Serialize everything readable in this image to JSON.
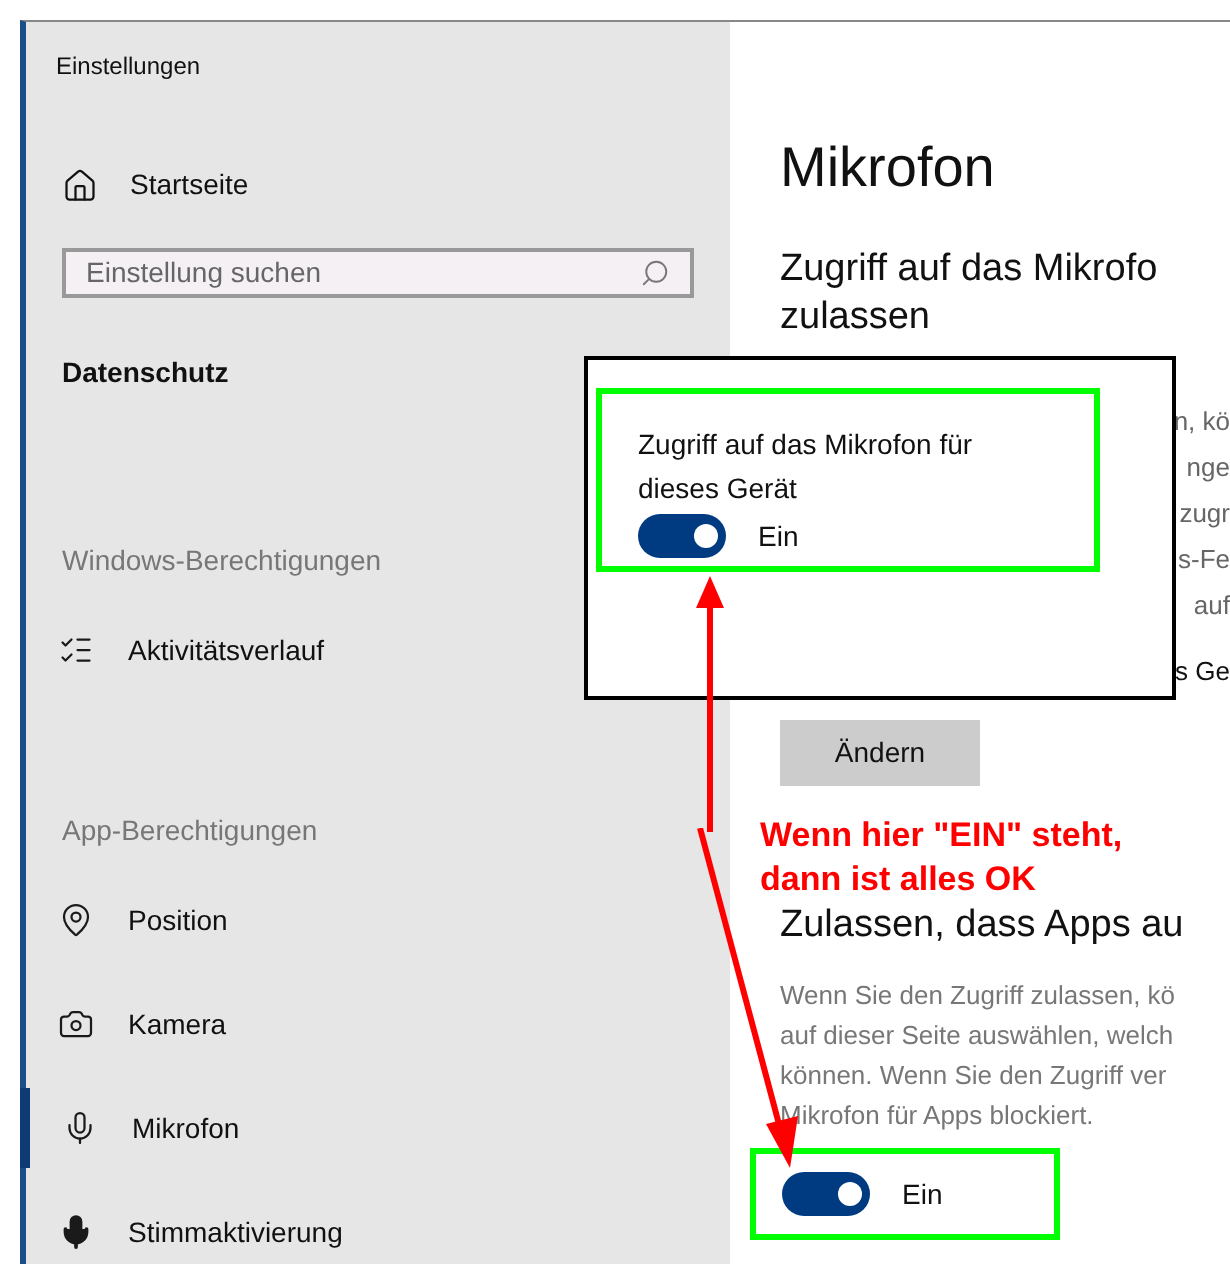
{
  "window": {
    "title": "Einstellungen"
  },
  "sidebar": {
    "home": {
      "label": "Startseite"
    },
    "search": {
      "placeholder": "Einstellung suchen"
    },
    "section_title": "Datenschutz",
    "groups": [
      {
        "heading": "Windows-Berechtigungen",
        "items": [
          {
            "label": "Aktivitätsverlauf",
            "kind": "activity",
            "selected": false
          }
        ]
      },
      {
        "heading": "App-Berechtigungen",
        "items": [
          {
            "label": "Position",
            "kind": "position",
            "selected": false
          },
          {
            "label": "Kamera",
            "kind": "camera",
            "selected": false
          },
          {
            "label": "Mikrofon",
            "kind": "microphone",
            "selected": true
          },
          {
            "label": "Stimmaktivierung",
            "kind": "voice",
            "selected": false
          }
        ]
      }
    ]
  },
  "content": {
    "title": "Mikrofon",
    "section1": {
      "heading": "Zugriff auf das Mikrofo",
      "heading_line2": "zulassen",
      "description_fragments": [
        "n, kö",
        "nge",
        "zugr",
        "s-Fe",
        "auf",
        "s Ge"
      ],
      "button": "Ändern"
    },
    "section2": {
      "heading": "Zulassen, dass Apps au",
      "description_lines": [
        "Wenn Sie den Zugriff zulassen, kö",
        "auf dieser Seite auswählen, welch",
        "können. Wenn Sie den Zugriff ver",
        "Mikrofon für Apps blockiert."
      ],
      "toggle": {
        "on": true,
        "label": "Ein"
      }
    }
  },
  "callout": {
    "text": "Zugriff auf das Mikrofon für dieses Gerät",
    "toggle": {
      "on": true,
      "label": "Ein"
    }
  },
  "annotation": {
    "lines": [
      "Wenn hier \"EIN\" steht,",
      "dann ist alles OK"
    ]
  }
}
